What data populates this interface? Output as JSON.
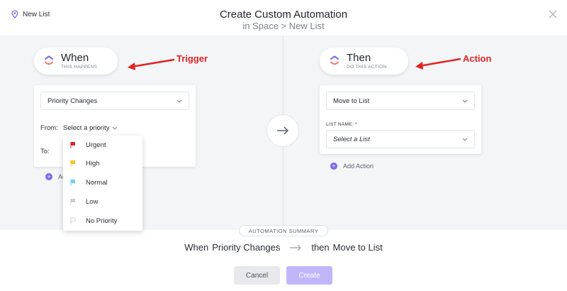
{
  "header": {
    "breadcrumb": "New List",
    "title": "Create Custom Automation",
    "subtitle": "in Space > New List"
  },
  "trigger": {
    "pill_title": "When",
    "pill_subtitle": "THIS HAPPENS",
    "annotation": "Trigger",
    "select_value": "Priority Changes",
    "from_label": "From:",
    "from_value": "Select a priority",
    "to_label": "To:",
    "add_action_fragment": "Ac",
    "priority_options": [
      {
        "label": "Urgent",
        "color": "#e02424"
      },
      {
        "label": "High",
        "color": "#f5c518"
      },
      {
        "label": "Normal",
        "color": "#6fd3f0"
      },
      {
        "label": "Low",
        "color": "#c9ccd1"
      },
      {
        "label": "No Priority",
        "color": "#d0d3d8"
      }
    ]
  },
  "action": {
    "pill_title": "Then",
    "pill_subtitle": "DO THIS ACTION",
    "annotation": "Action",
    "select_value": "Move to List",
    "list_name_label": "LIST NAME: *",
    "list_placeholder": "Select a List",
    "add_action": "Add Action"
  },
  "summary": {
    "badge": "AUTOMATION SUMMARY",
    "when_word": "When",
    "when_value": "Priority Changes",
    "then_word": "then",
    "then_value": "Move to List"
  },
  "buttons": {
    "cancel": "Cancel",
    "create": "Create"
  },
  "colors": {
    "accent": "#7b68ee",
    "annotation": "#e02424",
    "create_button": "#c2b6fb"
  }
}
